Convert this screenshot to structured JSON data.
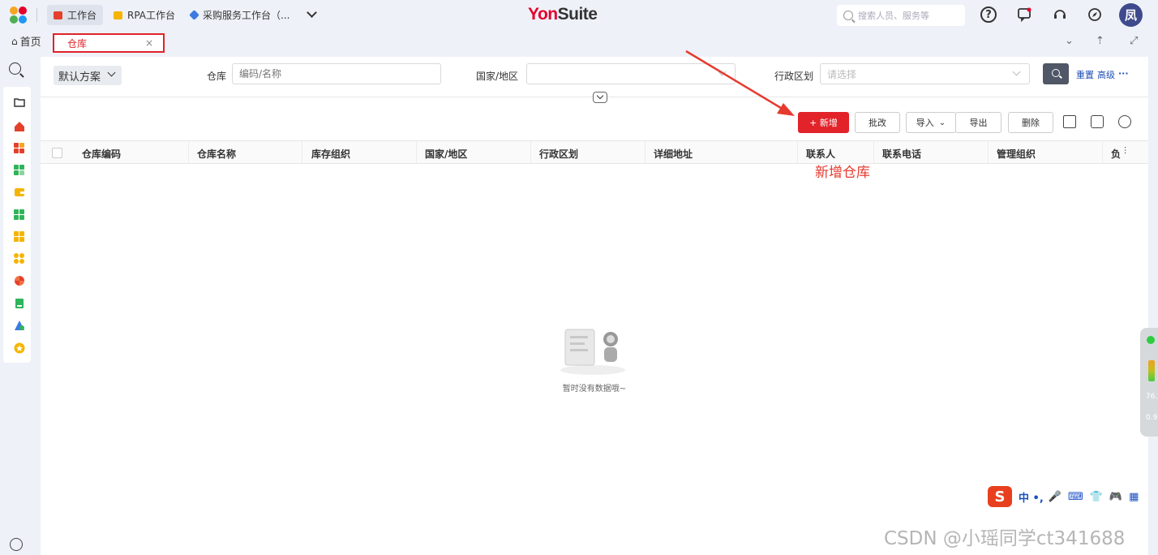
{
  "topbar": {
    "tabs": [
      {
        "label": "工作台"
      },
      {
        "label": "RPA工作台"
      },
      {
        "label": "采购服务工作台（..."
      }
    ],
    "brand_y": "Yon",
    "brand_suite": "Suite",
    "search_placeholder": "搜索人员、服务等",
    "avatar_text": "凤"
  },
  "tabstrip": {
    "home_label": "首页",
    "current_tab": "仓库",
    "close_glyph": "×"
  },
  "filters": {
    "scheme_label": "默认方案",
    "warehouse_label": "仓库",
    "warehouse_placeholder": "编码/名称",
    "country_label": "国家/地区",
    "region_label": "行政区划",
    "region_placeholder": "请选择",
    "reset_label": "重置",
    "advanced_label": "高级",
    "more_glyph": "···"
  },
  "toolbar": {
    "add_label": "+ 新增",
    "batch_edit_label": "批改",
    "import_label": "导入",
    "export_label": "导出",
    "delete_label": "删除"
  },
  "table": {
    "columns": [
      "仓库编码",
      "仓库名称",
      "库存组织",
      "国家/地区",
      "行政区划",
      "详细地址",
      "联系人",
      "联系电话",
      "管理组织",
      "负"
    ],
    "empty_text": "暂时没有数据哦~"
  },
  "annotation": {
    "text": "新增仓库"
  },
  "side_widget": {
    "value_1": "76.3",
    "value_2": "0.9"
  },
  "ime": {
    "logo": "S",
    "keys": "中 •, ",
    "colors": {
      "logo": "#e8401f"
    }
  },
  "watermark": "CSDN @小瑶同学ct341688",
  "colors": {
    "accent": "#e2232a",
    "annotation": "#e63a2e",
    "link": "#1f4fb5"
  }
}
